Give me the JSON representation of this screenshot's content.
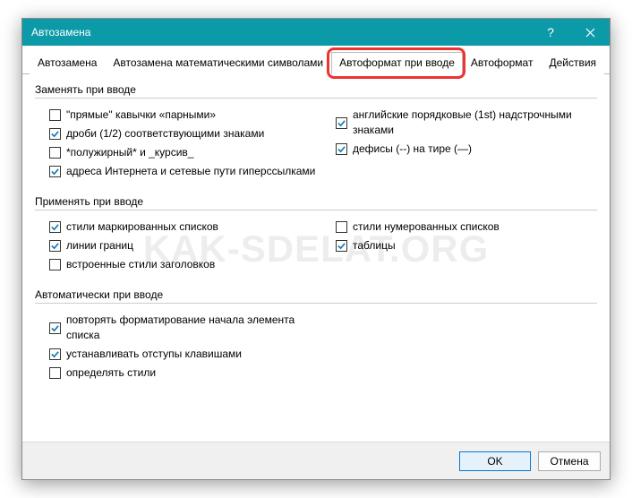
{
  "titlebar": {
    "title": "Автозамена"
  },
  "tabs": [
    {
      "label": "Автозамена",
      "active": false
    },
    {
      "label": "Автозамена математическими символами",
      "active": false
    },
    {
      "label": "Автоформат при вводе",
      "active": true,
      "highlighted": true
    },
    {
      "label": "Автоформат",
      "active": false
    },
    {
      "label": "Действия",
      "active": false
    }
  ],
  "groups": [
    {
      "title": "Заменять при вводе",
      "left": [
        {
          "checked": false,
          "label": "\"прямые\" кавычки «парными»"
        },
        {
          "checked": true,
          "label": "дроби (1/2) соответствующими знаками"
        },
        {
          "checked": false,
          "label": "*полужирный* и _курсив_"
        },
        {
          "checked": true,
          "label": "адреса Интернета и сетевые пути гиперссылками"
        }
      ],
      "right": [
        {
          "checked": true,
          "label": "английские порядковые (1st) надстрочными знаками"
        },
        {
          "checked": true,
          "label": "дефисы (--) на тире (—)"
        }
      ]
    },
    {
      "title": "Применять при вводе",
      "left": [
        {
          "checked": true,
          "label": "стили маркированных списков"
        },
        {
          "checked": true,
          "label": "линии границ"
        },
        {
          "checked": false,
          "label": "встроенные стили заголовков"
        }
      ],
      "right": [
        {
          "checked": false,
          "label": "стили нумерованных списков"
        },
        {
          "checked": true,
          "label": "таблицы"
        }
      ]
    },
    {
      "title": "Автоматически при вводе",
      "left": [
        {
          "checked": true,
          "label": "повторять форматирование начала элемента списка"
        },
        {
          "checked": true,
          "label": "устанавливать отступы клавишами"
        },
        {
          "checked": false,
          "label": "определять стили"
        }
      ],
      "right": []
    }
  ],
  "buttons": {
    "ok": "OK",
    "cancel": "Отмена"
  },
  "watermark": "KAK-SDELAT.ORG"
}
